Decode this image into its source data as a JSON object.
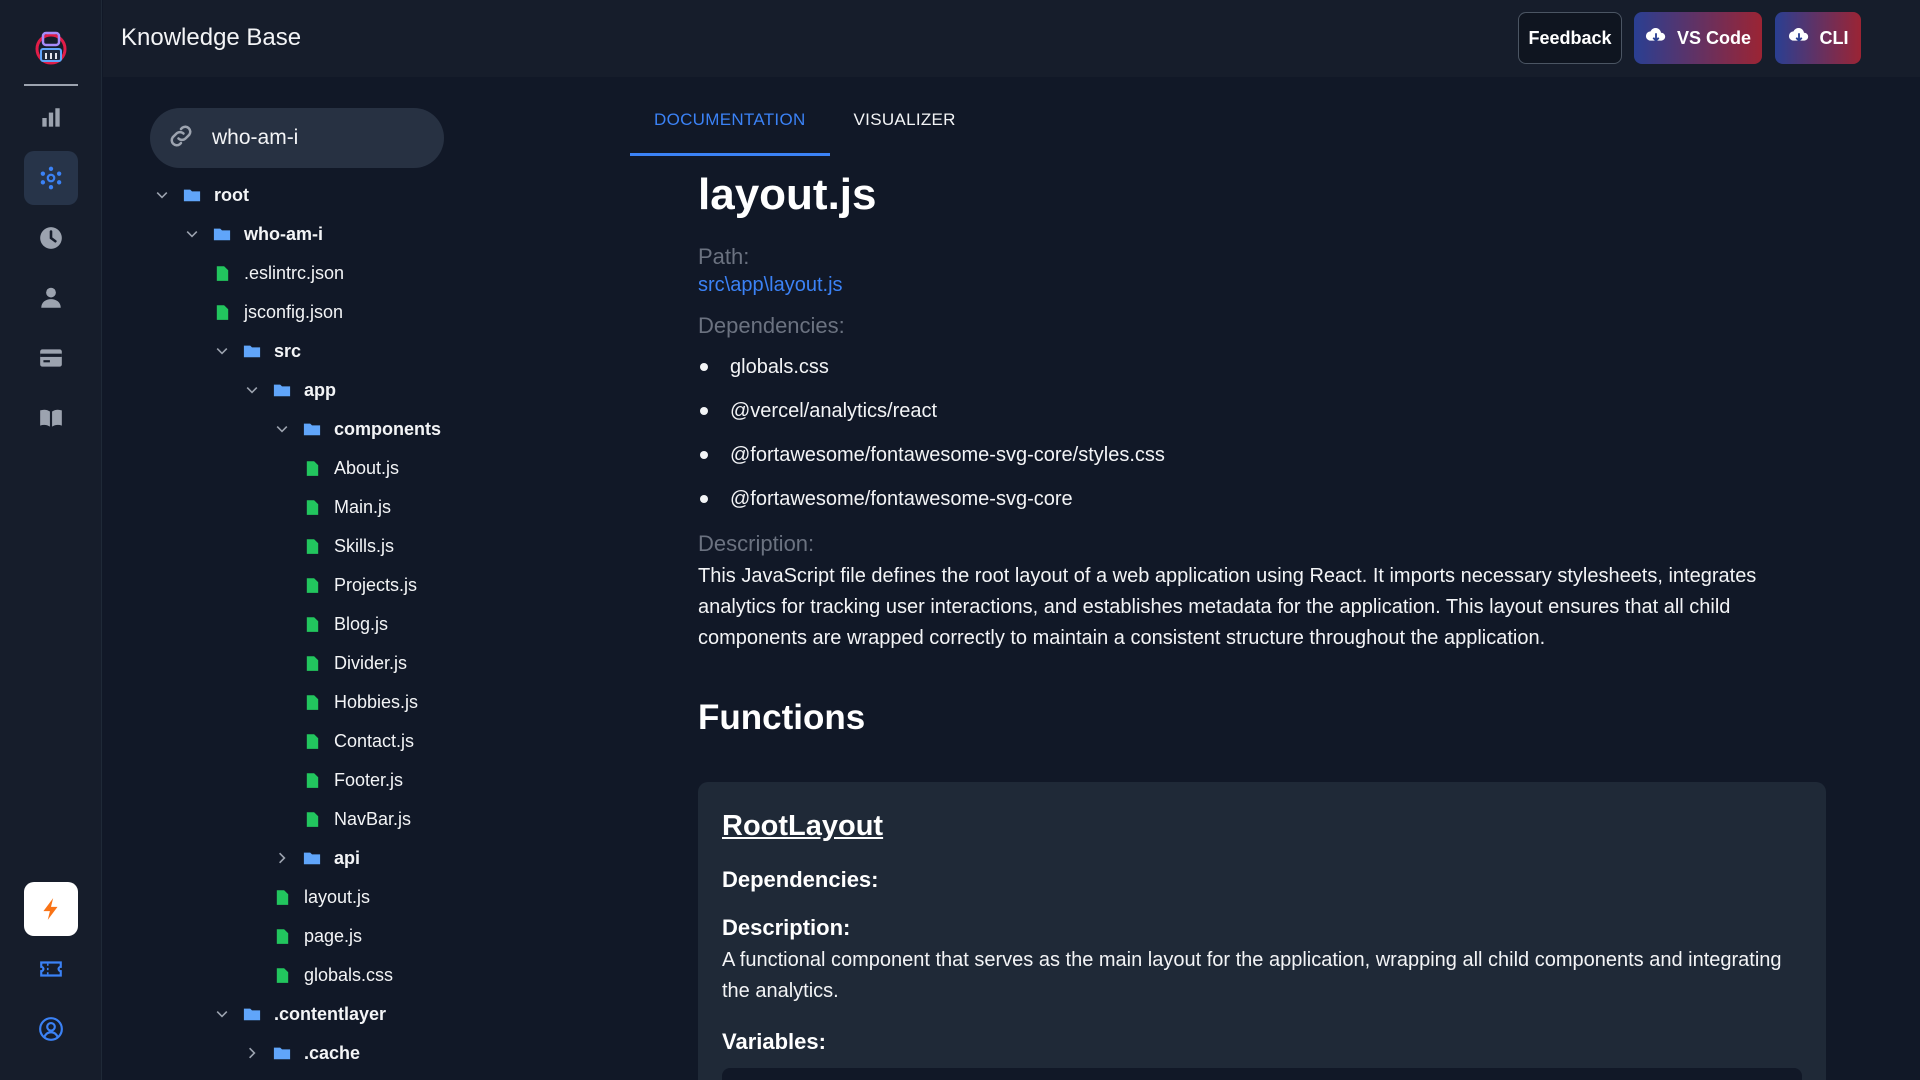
{
  "app": {
    "title": "Knowledge Base"
  },
  "topbar": {
    "feedback_label": "Feedback",
    "vscode_label": "VS Code",
    "cli_label": "CLI"
  },
  "rail": {
    "items": [
      "logo-icon",
      "chart-icon",
      "network-icon",
      "clock-icon",
      "user-icon",
      "card-icon",
      "book-icon",
      "bolt-icon",
      "ticket-icon",
      "account-icon"
    ]
  },
  "tree": {
    "search_value": "who-am-i",
    "nodes": [
      {
        "label": "root",
        "type": "folder",
        "open": true
      },
      {
        "label": "who-am-i",
        "type": "folder",
        "open": true
      },
      {
        "label": ".eslintrc.json",
        "type": "file"
      },
      {
        "label": "jsconfig.json",
        "type": "file"
      },
      {
        "label": "src",
        "type": "folder",
        "open": true
      },
      {
        "label": "app",
        "type": "folder",
        "open": true
      },
      {
        "label": "components",
        "type": "folder",
        "open": true
      },
      {
        "label": "About.js",
        "type": "file"
      },
      {
        "label": "Main.js",
        "type": "file"
      },
      {
        "label": "Skills.js",
        "type": "file"
      },
      {
        "label": "Projects.js",
        "type": "file"
      },
      {
        "label": "Blog.js",
        "type": "file"
      },
      {
        "label": "Divider.js",
        "type": "file"
      },
      {
        "label": "Hobbies.js",
        "type": "file"
      },
      {
        "label": "Contact.js",
        "type": "file"
      },
      {
        "label": "Footer.js",
        "type": "file"
      },
      {
        "label": "NavBar.js",
        "type": "file"
      },
      {
        "label": "api",
        "type": "folder",
        "open": false
      },
      {
        "label": "layout.js",
        "type": "file"
      },
      {
        "label": "page.js",
        "type": "file"
      },
      {
        "label": "globals.css",
        "type": "file"
      },
      {
        "label": ".contentlayer",
        "type": "folder",
        "open": true
      },
      {
        "label": ".cache",
        "type": "folder",
        "open": false
      }
    ]
  },
  "tabs": [
    {
      "label": "DOCUMENTATION",
      "active": true
    },
    {
      "label": "VISUALIZER",
      "active": false
    }
  ],
  "doc": {
    "filename": "layout.js",
    "path_label": "Path:",
    "path": "src\\app\\layout.js",
    "deps_label": "Dependencies:",
    "dependencies": [
      "globals.css",
      "@vercel/analytics/react",
      "@fortawesome/fontawesome-svg-core/styles.css",
      "@fortawesome/fontawesome-svg-core"
    ],
    "desc_label": "Description:",
    "description": "This JavaScript file defines the root layout of a web application using React. It imports necessary stylesheets, integrates analytics for tracking user interactions, and establishes metadata for the application. This layout ensures that all child components are wrapped correctly to maintain a consistent structure throughout the application.",
    "functions_heading": "Functions"
  },
  "function_card": {
    "name": "RootLayout",
    "deps_label": "Dependencies:",
    "desc_label": "Description:",
    "description": "A functional component that serves as the main layout for the application, wrapping all child components and integrating the analytics.",
    "vars_label": "Variables:"
  },
  "colors": {
    "background": "#111827",
    "accent": "#3b82f6",
    "file_icon": "#22c55e",
    "folder_icon": "#60a5fa"
  }
}
